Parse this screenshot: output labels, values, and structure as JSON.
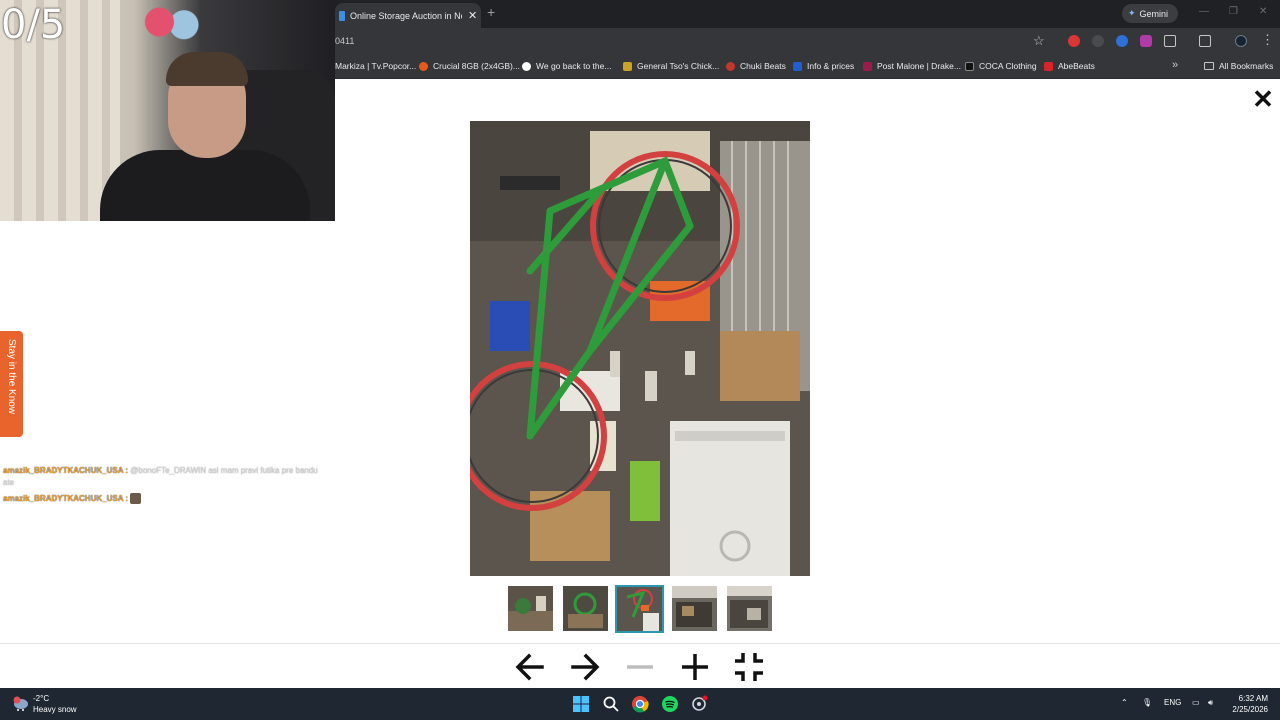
{
  "overlay": {
    "counter": "0/5",
    "stay_tab": "Stay in the Know",
    "chat": [
      {
        "user": "amazik_BRADYTKACHUK_USA :",
        "message": " @bonoFTe_DRAWIN asi mam pravi futika pre bandu",
        "continuation": "ate"
      },
      {
        "user": "amazik_BRADYTKACHUK_USA :",
        "message": "",
        "continuation": ""
      }
    ]
  },
  "browser": {
    "tab": {
      "title": "Online Storage Auction in New"
    },
    "url_fragment": "0411",
    "gemini_label": "Gemini",
    "bookmarks": [
      {
        "label": "Markiza | Tv.Popcor...",
        "color": "#3b3b3b"
      },
      {
        "label": "Crucial 8GB (2x4GB)...",
        "color": "#e8581d"
      },
      {
        "label": "We go back to the...",
        "color": "#ffffff"
      },
      {
        "label": "General Tso's Chick...",
        "color": "#c9a227"
      },
      {
        "label": "Chuki Beats",
        "color": "#c0392b"
      },
      {
        "label": "Info & prices",
        "color": "#1f5fd1"
      },
      {
        "label": "Post Malone | Drake...",
        "color": "#9b1b4a"
      },
      {
        "label": "COCA Clothing",
        "color": "#111111"
      },
      {
        "label": "AbeBeats",
        "color": "#d9252a"
      }
    ],
    "all_bookmarks": "All Bookmarks"
  },
  "lightbox": {
    "image_count": 5,
    "active_thumbnail": 3,
    "accent": "#2d96b0"
  },
  "taskbar": {
    "temperature": "-2°C",
    "weather": "Heavy snow",
    "language": "ENG",
    "time": "6:32 AM",
    "date": "2/25/2026"
  }
}
